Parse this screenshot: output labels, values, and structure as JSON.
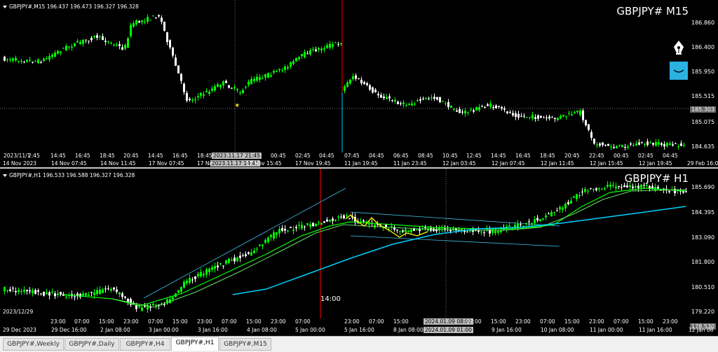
{
  "colors": {
    "background": "#000000",
    "candle_bull": "#00ff00",
    "candle_bear": "#ffffff",
    "ma_fast": "#00ff00",
    "ma_mid": "#ffff00",
    "ma_slow": "#00d0ff",
    "period_separator": "#ff0000",
    "channel": "#40c0e0"
  },
  "chart1": {
    "header": "GBPJPY#,M15  196.437 196.473 196.327 196.328",
    "title": "GBPJPY# M15",
    "prices": [
      "186.860",
      "186.400",
      "185.950",
      "185.515",
      "185.075",
      "184.635"
    ],
    "price_box": "185.303",
    "time_labels": [
      "14 Nov 2023",
      "14 Nov 07:45",
      "14 Nov 11:45",
      "17 Nov 07:45",
      "17 No",
      "17 Nov 15:45",
      "17 Nov 19:45",
      "11 Jan 19:45",
      "11 Jan 23:45",
      "12 Jan 03:45",
      "12 Jan 07:45",
      "12 Jan 11:45",
      "12 Jan 15:45",
      "12 Jan 19:45",
      "29 Feb 16:0"
    ],
    "time_box": "2023.11.17 14:45",
    "inner_labels": [
      "2023/11/1",
      "2:45",
      "14:45",
      "16:45",
      "18:45",
      "20:45",
      "14:45",
      "16:45",
      "18:45",
      "00:45",
      "02:45",
      "04:45",
      "07:45",
      "04:45",
      "06:45",
      "08:45",
      "10:45",
      "12:45",
      "14:45",
      "16:45",
      "18:45",
      "20:45",
      "22:45",
      "00:45",
      "02:45",
      "04:45"
    ],
    "inner_box": "2023.11.17 21:45"
  },
  "chart2": {
    "header": "GBPJPY#,H1  196.533 196.588 196.327 196.328",
    "title": "GBPJPY# H1",
    "prices": [
      "185.690",
      "184.395",
      "183.090",
      "181.800",
      "180.510",
      "179.220"
    ],
    "price_box": "178.530",
    "time_labels": [
      "29 Dec 2023",
      "29 Dec 16:00",
      "2 Jan 08:00",
      "3 Jan 00:00",
      "3 Jan 16:00",
      "4 Jan 08:00",
      "5 Jan 00:00",
      "5 Jan 16:00",
      "8 Jan 08:00",
      "9 Jan 00:00",
      "9 Jan 16:00",
      "10 Jan 08:00",
      "11 Jan 00:00",
      "11 Jan 16:00",
      "12 Jan 08"
    ],
    "time_box": "2024.01.09 01:00",
    "inner_labels": [
      "2023/12/29",
      "23:00",
      "07:00",
      "15:00",
      "23:00",
      "07:00",
      "15:00",
      "23:00",
      "07:00",
      "15:00",
      "23:00",
      "07:00",
      "23:00",
      "07:00",
      "15:00",
      "07:00",
      "15:00",
      "23:00",
      "07:00",
      "15:00",
      "23:00",
      "07:00",
      "15:00",
      "23:00",
      "07:00"
    ],
    "inner_box": "2024.01.09 08:00",
    "cursor_label": "14:00"
  },
  "tabs": [
    {
      "label": "GBPJPY#,Weekly",
      "active": false
    },
    {
      "label": "GBPJPY#,Daily",
      "active": false
    },
    {
      "label": "GBPJPY#,H4",
      "active": false
    },
    {
      "label": "GBPJPY#,H1",
      "active": true
    },
    {
      "label": "GBPJPY#,M15",
      "active": false
    }
  ]
}
